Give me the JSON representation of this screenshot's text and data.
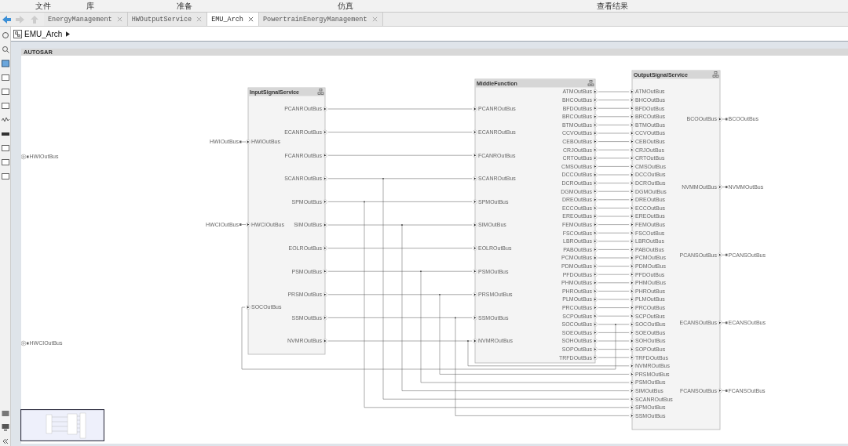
{
  "ribbon": {
    "sections": [
      "文件",
      "库",
      "准备",
      "仿真",
      "查看结果"
    ]
  },
  "tabs": [
    {
      "label": "EnergyManagement",
      "selected": false
    },
    {
      "label": "HWOutputService",
      "selected": false
    },
    {
      "label": "EMU_Arch",
      "selected": true
    },
    {
      "label": "PowertrainEnergyManagement",
      "selected": false
    }
  ],
  "breadcrumb": {
    "label": "EMU_Arch"
  },
  "canvas": {
    "header": "AUTOSAR",
    "root_inports": [
      "HWIOutBus",
      "HWCIOutBus"
    ],
    "blocks": [
      {
        "title": "InputSignalService",
        "inputs": [
          {
            "label": "HWIOutBus",
            "tag": "HWIOutBus"
          },
          {
            "label": "HWCIOutBus",
            "tag": "HWCIOutBus"
          },
          {
            "label": "SOCOutBus"
          }
        ],
        "outputs": [
          "PCANROutBus",
          "ECANROutBus",
          "FCANROutBus",
          "SCANROutBus",
          "SPMOutBus",
          "SIMOutBus",
          "EOLROutBus",
          "PSMOutBus",
          "PRSMOutBus",
          "SSMOutBus",
          "NVMROutBus"
        ]
      },
      {
        "title": "MiddleFunction",
        "inputs": [
          {
            "label": "PCANROutBus"
          },
          {
            "label": "ECANROutBus"
          },
          {
            "label": "FCANROutBus"
          },
          {
            "label": "SCANROutBus"
          },
          {
            "label": "SPMOutBus"
          },
          {
            "label": "SIMOutBus"
          },
          {
            "label": "EOLROutBus"
          },
          {
            "label": "PSMOutBus"
          },
          {
            "label": "PRSMOutBus"
          },
          {
            "label": "SSMOutBus"
          },
          {
            "label": "NVMROutBus"
          }
        ],
        "outputs": [
          "ATMOutBus",
          "BHCOutBus",
          "BFDOutBus",
          "BRCOutBus",
          "BTMOutBus",
          "CCVOutBus",
          "CEBOutBus",
          "CRJOutBus",
          "CRTOutBus",
          "CMSOutBus",
          "DCCOutBus",
          "DCROutBus",
          "DGMOutBus",
          "DREOutBus",
          "ECCOutBus",
          "EREOutBus",
          "FEMOutBus",
          "FSCOutBus",
          "LBROutBus",
          "PABOutBus",
          "PCMOutBus",
          "PDMOutBus",
          "PFDOutBus",
          "PHMOutBus",
          "PHROutBus",
          "PLMOutBus",
          "PRCOutBus",
          "SCPOutBus",
          "SOCOutBus",
          "SOEOutBus",
          "SOHOutBus",
          "SOPOutBus",
          "TRFDOutBus"
        ]
      },
      {
        "title": "OutputSignalService",
        "inputs": [
          {
            "label": "ATMOutBus"
          },
          {
            "label": "BHCOutBus"
          },
          {
            "label": "BFDOutBus"
          },
          {
            "label": "BRCOutBus"
          },
          {
            "label": "BTMOutBus"
          },
          {
            "label": "CCVOutBus"
          },
          {
            "label": "CEBOutBus"
          },
          {
            "label": "CRJOutBus"
          },
          {
            "label": "CRTOutBus"
          },
          {
            "label": "CMSOutBus"
          },
          {
            "label": "DCCOutBus"
          },
          {
            "label": "DCROutBus"
          },
          {
            "label": "DGMOutBus"
          },
          {
            "label": "DREOutBus"
          },
          {
            "label": "ECCOutBus"
          },
          {
            "label": "EREOutBus"
          },
          {
            "label": "FEMOutBus"
          },
          {
            "label": "FSCOutBus"
          },
          {
            "label": "LBROutBus"
          },
          {
            "label": "PABOutBus"
          },
          {
            "label": "PCMOutBus"
          },
          {
            "label": "PDMOutBus"
          },
          {
            "label": "PFDOutBus"
          },
          {
            "label": "PHMOutBus"
          },
          {
            "label": "PHROutBus"
          },
          {
            "label": "PLMOutBus"
          },
          {
            "label": "PRCOutBus"
          },
          {
            "label": "SCPOutBus"
          },
          {
            "label": "SOCOutBus"
          },
          {
            "label": "SOEOutBus"
          },
          {
            "label": "SOHOutBus"
          },
          {
            "label": "SOPOutBus"
          },
          {
            "label": "TRFDOutBus"
          },
          {
            "label": "NVMROutBus"
          },
          {
            "label": "PRSMOutBus"
          },
          {
            "label": "PSMOutBus"
          },
          {
            "label": "SIMOutBus"
          },
          {
            "label": "SCANROutBus"
          },
          {
            "label": "SPMOutBus"
          },
          {
            "label": "SSMOutBus"
          }
        ],
        "outputs": [
          "BCOOutBus",
          "NVMMOutBus",
          "PCANSOutBus",
          "ECANSOutBus",
          "FCANSOutBus"
        ]
      }
    ],
    "root_outports": [
      "BCOOutBus",
      "NVMMOutBus",
      "PCANSOutBus",
      "ECANSOutBus",
      "FCANSOutBus"
    ]
  }
}
